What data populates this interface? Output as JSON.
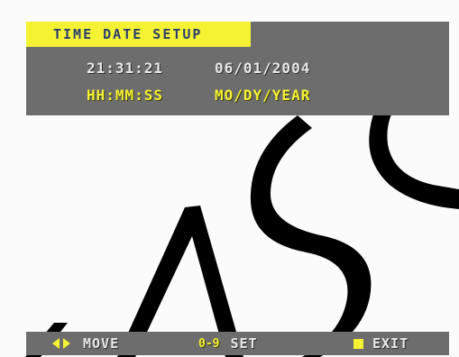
{
  "title": "TIME DATE SETUP",
  "time": {
    "value": "21:31:21",
    "format": "HH:MM:SS"
  },
  "date": {
    "value": "06/01/2004",
    "format": "MO/DY/YEAR"
  },
  "footer": {
    "move_label": "MOVE",
    "set_digits": "0-9",
    "set_label": "SET",
    "exit_label": "EXIT",
    "move_icon": "left-right-arrows-icon",
    "exit_icon": "square-icon"
  },
  "colors": {
    "osd_yellow": "#f5f233",
    "osd_gray": "#6d6d6d",
    "osd_text": "#e8e8e8",
    "title_text": "#2b3f6e",
    "background": "#fbfbfb"
  }
}
